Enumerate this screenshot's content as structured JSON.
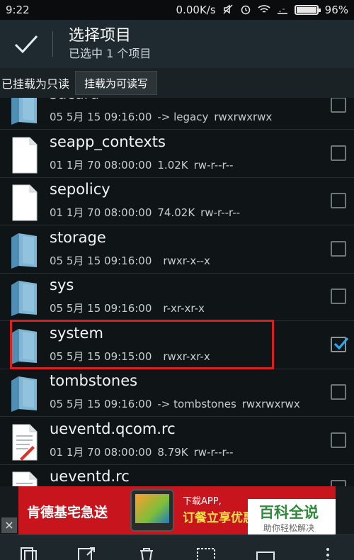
{
  "status_bar": {
    "time": "9:22",
    "network_speed": "0.00K/s",
    "battery": "96%",
    "battery_level": 0.96
  },
  "action_bar": {
    "title": "选择项目",
    "subtitle": "已选中 1 个项目"
  },
  "mount_bar": {
    "status_label": "已挂载为只读",
    "remount_button": "挂载为可读写"
  },
  "files": [
    {
      "name": "sdcard",
      "date": "05 5月 15 09:16:00",
      "info": "-> legacy",
      "perms": "rwxrwxrwx",
      "type": "folder",
      "checked": false
    },
    {
      "name": "seapp_contexts",
      "date": "01 1月 70 08:00:00",
      "info": "1.02K",
      "perms": "rw-r--r--",
      "type": "file",
      "checked": false
    },
    {
      "name": "sepolicy",
      "date": "01 1月 70 08:00:00",
      "info": "74.02K",
      "perms": "rw-r--r--",
      "type": "file",
      "checked": false
    },
    {
      "name": "storage",
      "date": "05 5月 15 09:16:00",
      "info": "",
      "perms": "rwxr-x--x",
      "type": "folder",
      "checked": false
    },
    {
      "name": "sys",
      "date": "05 5月 15 09:16:00",
      "info": "",
      "perms": "r-xr-xr-x",
      "type": "folder",
      "checked": false
    },
    {
      "name": "system",
      "date": "05 5月 15 09:15:00",
      "info": "",
      "perms": "rwxr-xr-x",
      "type": "folder",
      "checked": true
    },
    {
      "name": "tombstones",
      "date": "05 5月 15 09:16:00",
      "info": "-> tombstones",
      "perms": "rwxrwxrwx",
      "type": "folder",
      "checked": false
    },
    {
      "name": "ueventd.qcom.rc",
      "date": "01 1月 70 08:00:00",
      "info": "8.79K",
      "perms": "rw-r--r--",
      "type": "textfile",
      "checked": false
    },
    {
      "name": "ueventd.rc",
      "date": "",
      "info": "",
      "perms": "",
      "type": "textfile",
      "checked": false
    }
  ],
  "ad": {
    "brand": "肯德基宅急送",
    "line1": "下载APP,",
    "line2": "订餐立享优惠",
    "close": "×"
  },
  "watermark": {
    "title": "百科全说",
    "subtitle": "助你轻松解决"
  },
  "bottom_bar": {
    "icons": [
      "copy-icon",
      "cut-icon",
      "delete-icon",
      "select-all-icon",
      "rename-icon",
      "more-icon"
    ]
  }
}
